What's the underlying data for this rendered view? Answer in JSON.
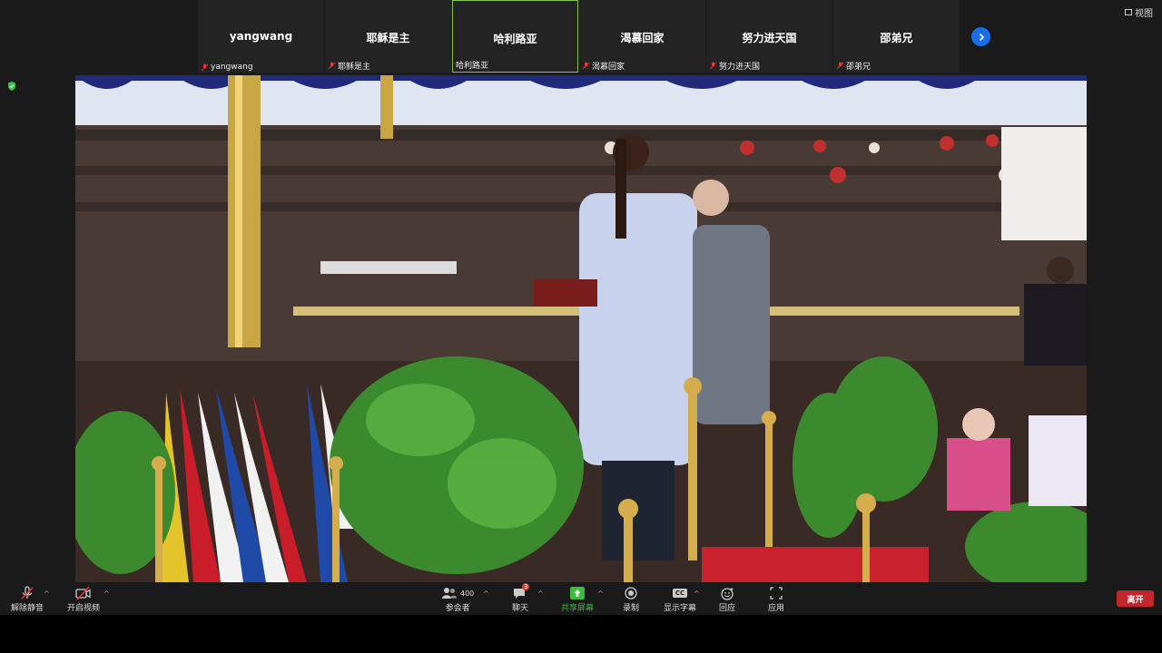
{
  "top": {
    "view_label": "视图"
  },
  "participants": [
    {
      "name": "yangwang",
      "label": "yangwang",
      "active": false
    },
    {
      "name": "耶稣是主",
      "label": "耶稣是主",
      "active": false
    },
    {
      "name": "哈利路亚",
      "label": "哈利路亚",
      "active": true
    },
    {
      "name": "渴慕回家",
      "label": "渴慕回家",
      "active": false
    },
    {
      "name": "努力进天国",
      "label": "努力进天国",
      "active": false
    },
    {
      "name": "邵弟兄",
      "label": "邵弟兄",
      "active": false
    }
  ],
  "toolbar": {
    "unmute_label": "解除静音",
    "start_video_label": "开启视频",
    "participants_label": "参会者",
    "participants_count": "400",
    "chat_label": "聊天",
    "chat_badge": "3",
    "share_label": "共享屏幕",
    "record_label": "录制",
    "captions_label": "显示字幕",
    "captions_icon_text": "CC",
    "reactions_label": "回应",
    "apps_label": "应用",
    "leave_label": "离开"
  },
  "colors": {
    "share_green": "#3dbb3d",
    "leave_red": "#c2272d",
    "next_blue": "#1a6ee6",
    "active_border": "#8bc34a"
  }
}
